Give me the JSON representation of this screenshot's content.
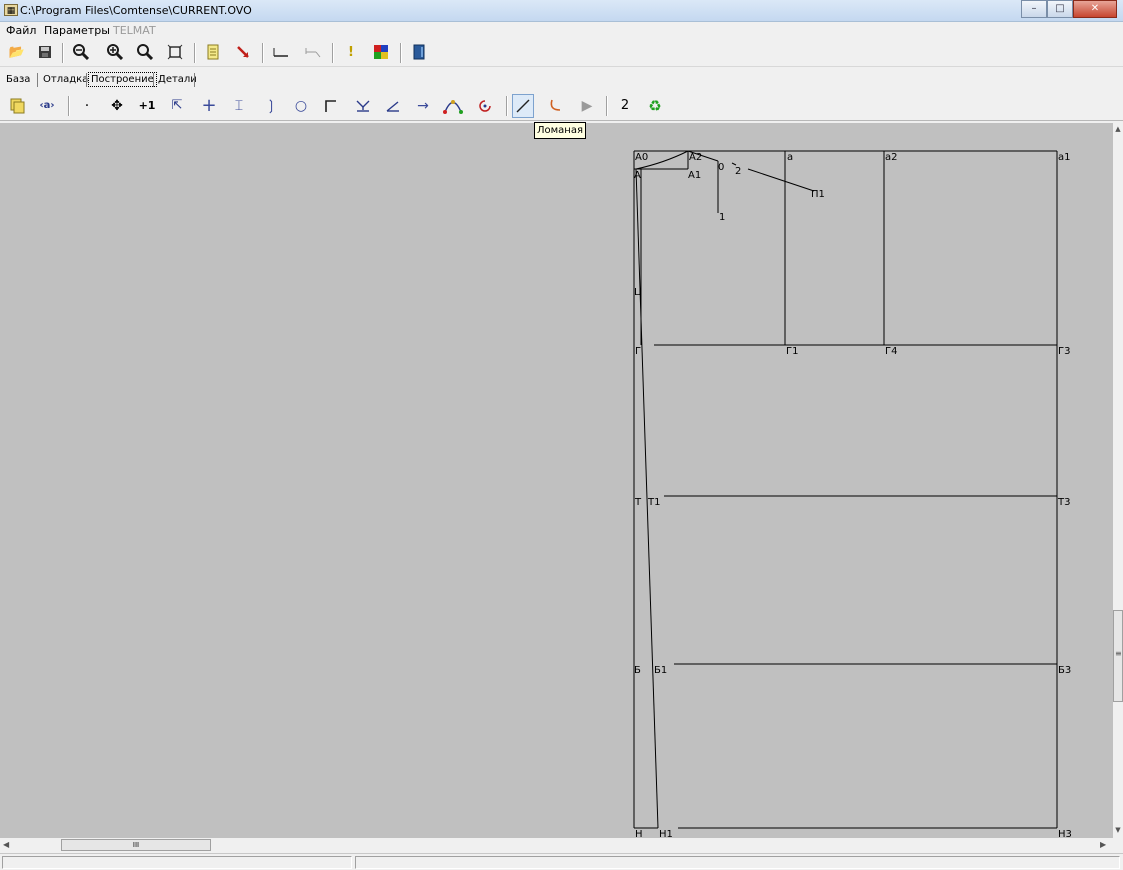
{
  "window": {
    "title": "C:\\Program Files\\Comtense\\CURRENT.OVO",
    "app_icon": "app-icon",
    "controls": [
      "minimize-icon",
      "maximize-icon",
      "close-icon"
    ]
  },
  "menu": {
    "items": [
      {
        "label": "Файл",
        "enabled": true
      },
      {
        "label": "Параметры",
        "enabled": true
      },
      {
        "label": "TELMAT",
        "enabled": false
      }
    ]
  },
  "toolbar": {
    "icons": [
      "open-folder-icon",
      "save-icon",
      "zoom-out-icon",
      "zoom-in-icon",
      "zoom-icon",
      "fit-window-icon",
      "notes-icon",
      "pointer-arrow-icon",
      "measure-line-icon",
      "measure-angle-icon",
      "alert-icon",
      "color-palette-icon",
      "book-icon"
    ]
  },
  "tabs": {
    "items": [
      "База",
      "Отладка",
      "Построение",
      "Детали"
    ],
    "active": "Построение"
  },
  "build_toolbar": {
    "icons": [
      "layers-icon",
      "eye-tag-icon",
      "point-icon",
      "move-cross-icon",
      "plus-one-icon",
      "select-cursor-icon",
      "crosshair-icon",
      "split-icon",
      "arc-right-icon",
      "circle-point-icon",
      "corner-icon",
      "perpendicular-icon",
      "angle-icon",
      "arrow-right-icon",
      "curve-icon",
      "rotate-icon",
      "polyline-icon",
      "arc-tool-icon",
      "play-icon"
    ],
    "number_label": "2",
    "recycle_icon": "recycle-icon",
    "pressed": "polyline-icon",
    "tooltip": "Ломаная"
  },
  "drawing": {
    "point_labels": [
      "А0",
      "А2",
      "А",
      "А1",
      "0",
      "2",
      "1",
      "П1",
      "а",
      "а2",
      "а1",
      "Ц",
      "Г",
      "Г1",
      "Г4",
      "Г3",
      "Т",
      "Т1",
      "Т3",
      "Б",
      "Б1",
      "Б3",
      "Н",
      "Н1",
      "Н3"
    ]
  },
  "colors": {
    "canvas": "#c0c0c0",
    "window_chrome": "#f0f0f0",
    "tooltip_bg": "#ffffe1",
    "pressed_button": "#ddeaf8"
  },
  "scrollbars": {
    "horizontal_grip": "III",
    "vertical_grip": "≡"
  },
  "statusbar": {
    "panes": [
      "",
      ""
    ]
  }
}
